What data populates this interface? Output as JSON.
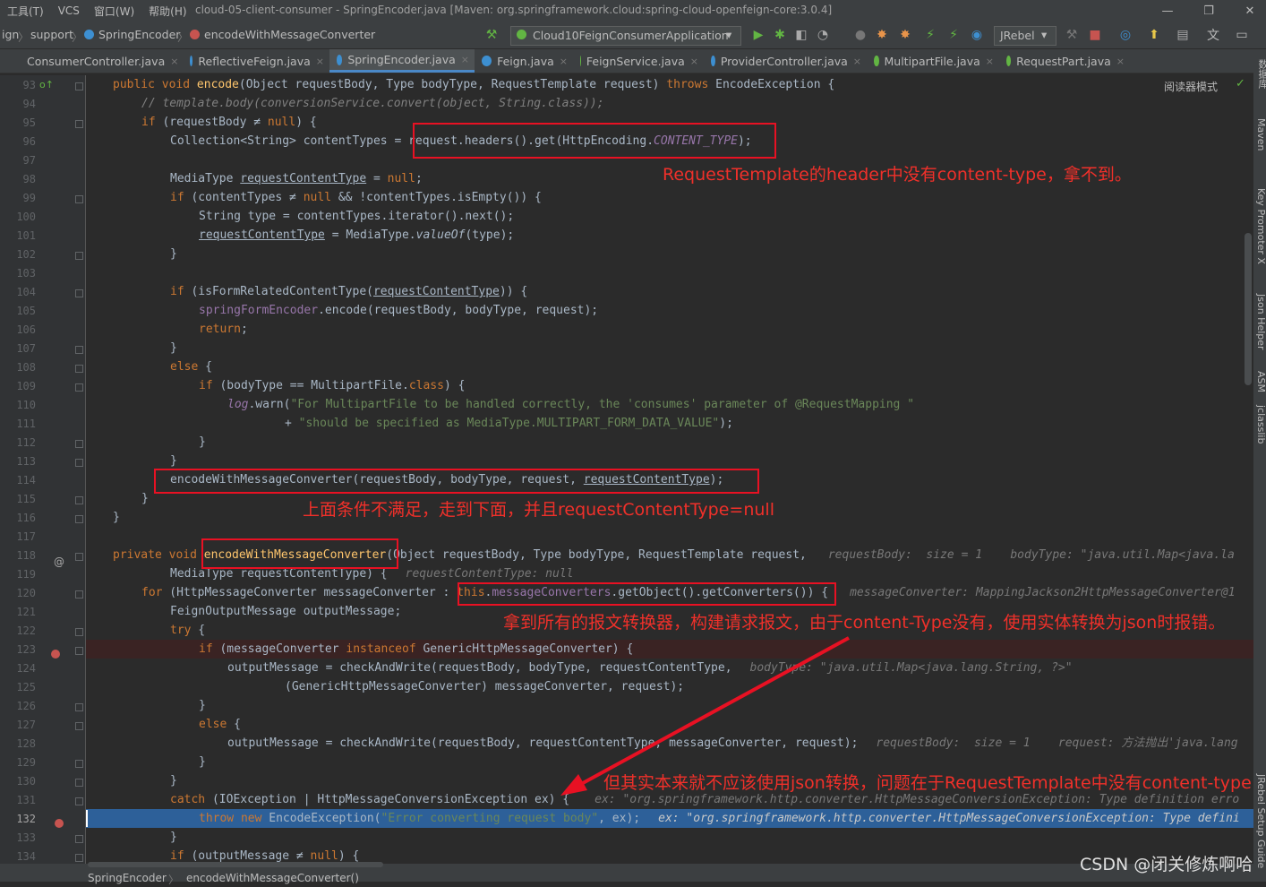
{
  "menubar": {
    "items": [
      "工具(T)",
      "VCS",
      "窗口(W)",
      "帮助(H)"
    ],
    "window_title": "cloud-05-client-consumer - SpringEncoder.java [Maven: org.springframework.cloud:spring-cloud-openfeign-core:3.0.4]",
    "minimize": "—",
    "restore": "❐",
    "close": "✕"
  },
  "navbar": {
    "breadcrumbs": [
      "ign",
      "support",
      "SpringEncoder",
      "encodeWithMessageConverter"
    ],
    "sep": "〉",
    "run_config": "Cloud10FeignConsumerApplication",
    "jrebel": "JRebel",
    "dropdown_arrow": "▾"
  },
  "tabs": [
    {
      "label": "ConsumerController.java",
      "color": "#3d8fd1"
    },
    {
      "label": "ReflectiveFeign.java",
      "color": "#3d8fd1"
    },
    {
      "label": "SpringEncoder.java",
      "color": "#3d8fd1"
    },
    {
      "label": "Feign.java",
      "color": "#3d8fd1"
    },
    {
      "label": "FeignService.java",
      "color": "#62b543"
    },
    {
      "label": "ProviderController.java",
      "color": "#3d8fd1"
    },
    {
      "label": "MultipartFile.java",
      "color": "#62b543"
    },
    {
      "label": "RequestPart.java",
      "color": "#62b543"
    }
  ],
  "tab_close": "×",
  "reader_mode": "阅读器模式",
  "line_numbers": [
    "93",
    "94",
    "95",
    "96",
    "97",
    "98",
    "99",
    "100",
    "101",
    "102",
    "103",
    "104",
    "105",
    "106",
    "107",
    "108",
    "109",
    "110",
    "111",
    "112",
    "113",
    "114",
    "115",
    "116",
    "117",
    "118",
    "119",
    "120",
    "121",
    "122",
    "123",
    "124",
    "125",
    "126",
    "127",
    "128",
    "129",
    "130",
    "131",
    "132",
    "133",
    "134"
  ],
  "code": {
    "l93": [
      "public void ",
      "encode",
      "(Object requestBody, Type bodyType, RequestTemplate request) ",
      "throws",
      " EncodeException {"
    ],
    "l94": "// template.body(conversionService.convert(object, String.class));",
    "l95": [
      "if",
      " (requestBody ≠ ",
      "null",
      ") {"
    ],
    "l96": [
      "Collection<String> contentTypes = request.headers().get(HttpEncoding.",
      "CONTENT_TYPE",
      ");"
    ],
    "l98": [
      "MediaType ",
      "requestContentType",
      " = ",
      "null",
      ";"
    ],
    "l99": [
      "if",
      " (contentTypes ≠ ",
      "null",
      " && !contentTypes.isEmpty()) {"
    ],
    "l100": "String type = contentTypes.iterator().next();",
    "l101": [
      "requestContentType",
      " = MediaType.",
      "valueOf",
      "(type);"
    ],
    "l102": "}",
    "l104": [
      "if",
      " (isFormRelatedContentType(",
      "requestContentType",
      ")) {"
    ],
    "l105": [
      "springFormEncoder",
      ".encode(requestBody, bodyType, request);"
    ],
    "l106": [
      "return",
      ";"
    ],
    "l107": "}",
    "l108": [
      "else",
      " {"
    ],
    "l109": [
      "if",
      " (bodyType == MultipartFile.",
      "class",
      ") {"
    ],
    "l110": [
      "log",
      ".warn(",
      "\"For MultipartFile to be handled correctly, the 'consumes' parameter of @RequestMapping \""
    ],
    "l111": [
      "+ ",
      "\"should be specified as MediaType.MULTIPART_FORM_DATA_VALUE\"",
      ");"
    ],
    "l112": "}",
    "l113": "}",
    "l114": [
      "encodeWithMessageConverter(requestBody, bodyType, request, ",
      "requestContentType",
      ");"
    ],
    "l115": "}",
    "l116": "}",
    "l118": [
      "private void ",
      "encodeWithMessageConverter",
      "(Object requestBody, Type bodyType, RequestTemplate request,",
      "requestBody:  size = 1    bodyType: \"java.util.Map<java.la"
    ],
    "l119": [
      "MediaType requestContentType) {",
      "requestContentType: null"
    ],
    "l120": [
      "for",
      " (HttpMessageConverter messageConverter : ",
      "this",
      ".",
      "messageConverters",
      ".getObject().getConverters()) {",
      "messageConverter: MappingJackson2HttpMessageConverter@1"
    ],
    "l121": "FeignOutputMessage outputMessage;",
    "l122": [
      "try",
      " {"
    ],
    "l123": [
      "if",
      " (messageConverter ",
      "instanceof",
      " GenericHttpMessageConverter) {"
    ],
    "l124": [
      "outputMessage = checkAndWrite(requestBody, bodyType, requestContentType,",
      "bodyType: \"java.util.Map<java.lang.String, ?>\""
    ],
    "l125": "(GenericHttpMessageConverter) messageConverter, request);",
    "l126": "}",
    "l127": [
      "else",
      " {"
    ],
    "l128": [
      "outputMessage = checkAndWrite(requestBody, requestContentType, messageConverter, request);",
      "requestBody:  size = 1    request: 方法抛出'java.lang"
    ],
    "l129": "}",
    "l130": "}",
    "l131": [
      "catch",
      " (IOException | HttpMessageConversionException ex) {",
      "ex: \"org.springframework.http.converter.HttpMessageConversionException: Type definition erro"
    ],
    "l132": [
      "throw new",
      " EncodeException(",
      "\"Error converting request body\"",
      ", ex);",
      "ex: \"org.springframework.http.converter.HttpMessageConversionException: Type defini"
    ],
    "l133": "}",
    "l134": [
      "if",
      " (outputMessage ≠ ",
      "null",
      ") {"
    ]
  },
  "annotations": {
    "a1": "RequestTemplate的header中没有content-type，拿不到。",
    "a2": "上面条件不满足，走到下面，并且requestContentType=null",
    "a3": "拿到所有的报文转换器，构建请求报文，由于content-Type没有，使用实体转换为json时报错。",
    "a4": "但其实本来就不应该使用json转换，问题在于RequestTemplate中没有content-type"
  },
  "right_sidebar": [
    "数据库",
    "Maven",
    "Key Promoter X",
    "Json Helper",
    "ASM",
    "jclasslib",
    "JRebel Setup Guide"
  ],
  "statusbar": {
    "crumbs": [
      "SpringEncoder",
      "encodeWithMessageConverter()"
    ],
    "sep": "〉"
  },
  "watermark": "CSDN @闭关修炼啊哈",
  "colors": {
    "annotation_red": "#e81123",
    "exec_line": "#2d6099",
    "keyword": "#cc7832"
  }
}
